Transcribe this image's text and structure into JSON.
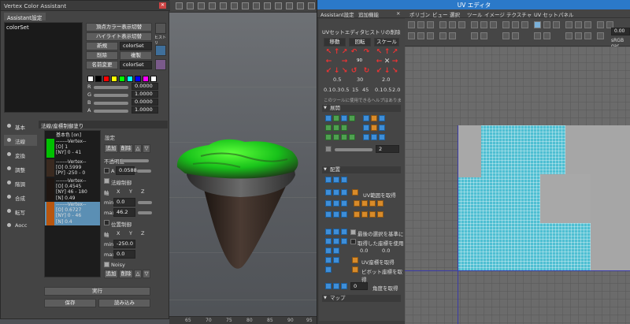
{
  "vca": {
    "title": "Vertex Color Assistant",
    "tab": "Assistant設定",
    "colorset_item": "colorSet",
    "buttons": {
      "vertex_color_display": "頂点カラー表示切替",
      "highlight_display": "ハイライト表示切替",
      "new": "新規",
      "delete": "削除",
      "duplicate": "複製",
      "rename": "名前変更"
    },
    "new_field": "colorSet",
    "rename_field": "colorSet",
    "side_icons_label": "ヒストリ",
    "rgba": [
      {
        "label": "R",
        "value": "0.0000"
      },
      {
        "label": "G",
        "value": "1.0000"
      },
      {
        "label": "B",
        "value": "0.0000"
      },
      {
        "label": "A",
        "value": "1.0000"
      }
    ],
    "palette_colors": [
      "#ffffff",
      "#000000",
      "#ff0000",
      "#ffff00",
      "#00ff00",
      "#00ffff",
      "#0000ff",
      "#ff00ff",
      "#ffffff"
    ],
    "sidebar": [
      "基本",
      "法線",
      "変換",
      "調整",
      "階調",
      "合成",
      "転写",
      "Aocc"
    ],
    "section_title": "法線/座標制御塗り",
    "base_color_label": "基本色 [on]",
    "vertex_blocks": [
      {
        "header": "-------Vertex--",
        "lines": [
          "[O] 1",
          "[NY] 0 - 41"
        ],
        "color": "#00c000"
      },
      {
        "header": "-------Vertex--",
        "lines": [
          "[O] 0.5999",
          "[PY] -250 - 0"
        ],
        "color": "#3a2a20"
      },
      {
        "header": "-------Vertex--",
        "lines": [
          "[O] 0.4545",
          "[NY] 46 - 180",
          "[N] 0.49"
        ],
        "color": "#3a2a20"
      },
      {
        "header": "-------Vertex--",
        "lines": [
          "[O] 0.6727",
          "[NY] 0 - 46",
          "[N] 0.4"
        ],
        "color": "#b8560f"
      }
    ],
    "settings": {
      "title": "設定",
      "add": "追加",
      "delete": "削除",
      "opacity_label": "不透明度",
      "a_label": "A",
      "a_value": "0.0588",
      "normal_control": "法線制御",
      "axis_label": "軸",
      "x": "X",
      "y": "Y",
      "z": "Z",
      "min_label": "min",
      "min_value": "0.0",
      "max_label": "max",
      "max_value": "46.2",
      "position_control": "位置制御",
      "min2_value": "-250.0",
      "max2_value": "0.0",
      "noisy": "Noisy",
      "add2": "追加",
      "delete2": "削除"
    },
    "execute": "実行",
    "save": "保存",
    "load": "読み込み"
  },
  "viewport": {
    "ruler_ticks": [
      "65",
      "70",
      "75",
      "80",
      "85",
      "90",
      "95"
    ]
  },
  "uv": {
    "title": "UV エディタ",
    "menu": [
      "ポリゴン",
      "ビュー",
      "選択",
      "ツール",
      "イメージ",
      "テクスチャ",
      "UV セット",
      "パネル"
    ],
    "toolkit_tabs": [
      "Assistant設定",
      "追加機能"
    ],
    "toolkit_close": "×",
    "uv_toolkit": "UVセットエディタ",
    "history_delete": "ヒストリの削除",
    "transform_headers": [
      "移動",
      "回転",
      "スケール"
    ],
    "move_value": "0.5",
    "rotate_value": "30",
    "scale_value": "2.0",
    "rotate_icon_label": "90",
    "presets_move": [
      "0.1",
      "0.3",
      "0.5"
    ],
    "presets_rotate": [
      "15",
      "45"
    ],
    "presets_scale": [
      "0.1",
      "0.5",
      "2.0"
    ],
    "help_text": "このツールに使用できるヘルプはありません",
    "section_unfold": "展開",
    "slider_value": "2",
    "section_arrange": "配置",
    "get_uv_range": "UV範囲を取得",
    "last_selection_based": "最後の選択を基準に",
    "use_fetched_coords": "取得した座標を使用",
    "coord_u": "0.0",
    "coord_v": "0.0",
    "get_uv_coords": "UV座標を取得",
    "get_pivot_coords": "ピボット座標を取得",
    "angle_value": "0",
    "get_angle": "角度を取得",
    "section_map": "マップ",
    "toolbar_value": "0.00",
    "colorspace": "sRGB gar"
  }
}
